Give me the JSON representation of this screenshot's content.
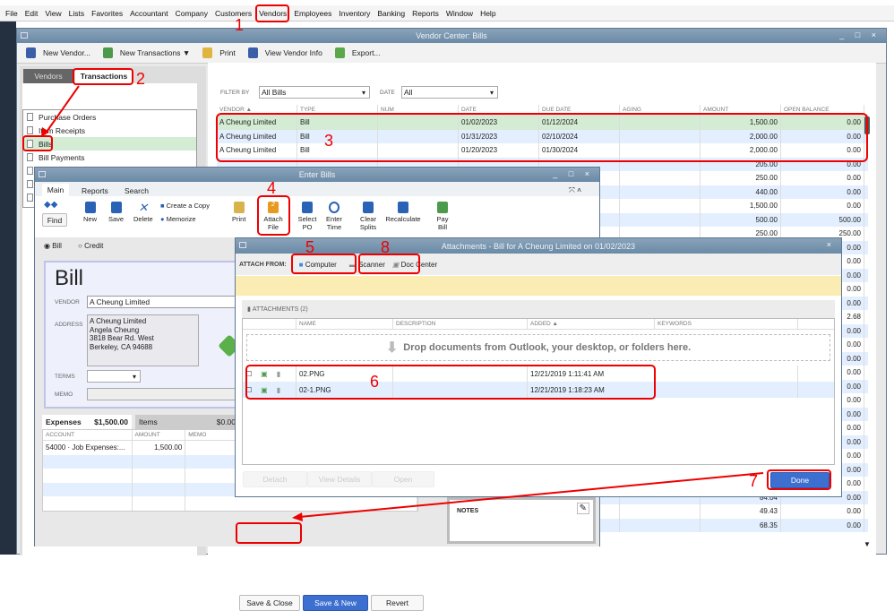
{
  "menu": [
    "File",
    "Edit",
    "View",
    "Lists",
    "Favorites",
    "Accountant",
    "Company",
    "Customers",
    "Vendors",
    "Employees",
    "Inventory",
    "Banking",
    "Reports",
    "Window",
    "Help"
  ],
  "vendor_center": {
    "title": "Vendor Center: Bills",
    "window_controls": "_ □ ×",
    "toolbar": {
      "new_vendor": "New Vendor...",
      "new_transactions": "New Transactions ▼",
      "print": "Print",
      "view_vendor_info": "View Vendor Info",
      "export": "Export..."
    },
    "tabs": {
      "vendors": "Vendors",
      "transactions": "Transactions"
    },
    "list": [
      "Purchase Orders",
      "Item Receipts",
      "Bills",
      "Bill Payments",
      "",
      "",
      ""
    ],
    "filter": {
      "filter_by_label": "FILTER BY",
      "filter_by_value": "All Bills",
      "date_label": "DATE",
      "date_value": "All"
    },
    "columns": [
      "VENDOR ▲",
      "TYPE",
      "NUM",
      "DATE",
      "DUE DATE",
      "AGING",
      "AMOUNT",
      "OPEN BALANCE"
    ],
    "rows": [
      [
        "A Cheung Limited",
        "Bill",
        "",
        "01/02/2023",
        "01/12/2024",
        "",
        "1,500.00",
        "0.00"
      ],
      [
        "A Cheung Limited",
        "Bill",
        "",
        "01/31/2023",
        "02/10/2024",
        "",
        "2,000.00",
        "0.00"
      ],
      [
        "A Cheung Limited",
        "Bill",
        "",
        "01/20/2023",
        "01/30/2024",
        "",
        "2,000.00",
        "0.00"
      ],
      [
        "",
        "",
        "",
        "",
        "",
        "",
        "205.00",
        "0.00"
      ],
      [
        "",
        "",
        "",
        "",
        "",
        "",
        "250.00",
        "0.00"
      ],
      [
        "",
        "",
        "",
        "",
        "",
        "",
        "440.00",
        "0.00"
      ],
      [
        "",
        "",
        "",
        "",
        "",
        "",
        "1,500.00",
        "0.00"
      ],
      [
        "",
        "",
        "",
        "",
        "",
        "",
        "500.00",
        "500.00"
      ],
      [
        "",
        "",
        "",
        "",
        "",
        "",
        "250.00",
        "250.00"
      ],
      [
        "",
        "",
        "",
        "",
        "",
        "",
        "",
        "0.00"
      ],
      [
        "",
        "",
        "",
        "",
        "",
        "",
        "",
        "0.00"
      ],
      [
        "",
        "",
        "",
        "",
        "",
        "",
        "",
        "0.00"
      ],
      [
        "",
        "",
        "",
        "",
        "",
        "",
        "",
        "0.00"
      ],
      [
        "",
        "",
        "",
        "",
        "",
        "",
        "",
        "0.00"
      ],
      [
        "",
        "",
        "",
        "",
        "",
        "",
        "",
        "2.68"
      ],
      [
        "",
        "",
        "",
        "",
        "",
        "",
        "",
        "0.00"
      ],
      [
        "",
        "",
        "",
        "",
        "",
        "",
        "",
        "0.00"
      ],
      [
        "",
        "",
        "",
        "",
        "",
        "",
        "",
        "0.00"
      ],
      [
        "",
        "",
        "",
        "",
        "",
        "",
        "",
        "0.00"
      ],
      [
        "",
        "",
        "",
        "",
        "",
        "",
        "",
        "0.00"
      ],
      [
        "",
        "",
        "",
        "",
        "",
        "",
        "",
        "0.00"
      ],
      [
        "",
        "",
        "",
        "",
        "",
        "",
        "",
        "0.00"
      ],
      [
        "",
        "",
        "",
        "",
        "",
        "",
        "",
        "0.00"
      ],
      [
        "",
        "",
        "",
        "",
        "",
        "",
        "",
        "0.00"
      ],
      [
        "",
        "",
        "",
        "",
        "",
        "",
        "",
        "0.00"
      ],
      [
        "",
        "",
        "",
        "",
        "",
        "",
        "",
        "0.00"
      ],
      [
        "",
        "",
        "",
        "",
        "",
        "",
        "",
        "0.00"
      ],
      [
        "",
        "",
        "",
        "",
        "",
        "",
        "84.04",
        "0.00"
      ],
      [
        "",
        "",
        "",
        "",
        "",
        "",
        "49.43",
        "0.00"
      ],
      [
        "",
        "",
        "",
        "",
        "",
        "",
        "68.35",
        "0.00"
      ]
    ]
  },
  "enter_bills": {
    "title": "Enter Bills",
    "window_controls": "_ □ ×",
    "tabs": [
      "Main",
      "Reports",
      "Search"
    ],
    "ribbon": {
      "find": "Find",
      "new": "New",
      "save": "Save",
      "delete": "Delete",
      "create_copy": "Create a Copy",
      "memorize": "Memorize",
      "print": "Print",
      "attach_file": "Attach File",
      "attach_count": "2",
      "select_po": "Select PO",
      "enter_time": "Enter Time",
      "clear_splits": "Clear Splits",
      "recalculate": "Recalculate",
      "pay_bill": "Pay Bill"
    },
    "type_bill": "Bill",
    "type_credit": "Credit",
    "form_title": "Bill",
    "vendor_label": "VENDOR",
    "vendor_value": "A Cheung Limited",
    "address_label": "ADDRESS",
    "address_lines": [
      "A Cheung Limited",
      "Angela Cheung",
      "3818 Bear Rd. West",
      "Berkeley, CA 94688"
    ],
    "terms_label": "TERMS",
    "memo_label": "MEMO",
    "expenses_tab": "Expenses",
    "expenses_total": "$1,500.00",
    "items_tab": "Items",
    "items_total": "$0.00",
    "columns": [
      "ACCOUNT",
      "AMOUNT",
      "MEMO"
    ],
    "lines": [
      [
        "54000 · Job Expenses:...",
        "1,500.00",
        ""
      ]
    ],
    "notes_label": "NOTES",
    "save_close": "Save & Close",
    "save_new": "Save & New",
    "revert": "Revert"
  },
  "attachments": {
    "title": "Attachments - Bill for A Cheung Limited on 01/02/2023",
    "close": "×",
    "attach_from": "ATTACH FROM:",
    "computer": "Computer",
    "scanner": "Scanner",
    "doc_center": "Doc Center",
    "header": "ATTACHMENTS (2)",
    "columns": [
      "NAME",
      "DESCRIPTION",
      "ADDED ▲",
      "KEYWORDS"
    ],
    "drop_text": "Drop documents from Outlook, your desktop, or folders here.",
    "files": [
      {
        "name": "02.PNG",
        "description": "",
        "added": "12/21/2019 1:11:41 AM",
        "keywords": ""
      },
      {
        "name": "02-1.PNG",
        "description": "",
        "added": "12/21/2019 1:18:23 AM",
        "keywords": ""
      }
    ],
    "detach": "Detach",
    "view_details": "View Details",
    "open": "Open",
    "done": "Done"
  },
  "annotations": [
    "1",
    "2",
    "3",
    "4",
    "5",
    "6",
    "7",
    "8"
  ],
  "colors": {
    "selected_row": "#d4ebd4",
    "alt_row": "#e3efff",
    "title_bar": "#6a8aa6",
    "done_button": "#3d6fd0",
    "annotation": "#e00000",
    "notice_band": "#fbecb4"
  }
}
